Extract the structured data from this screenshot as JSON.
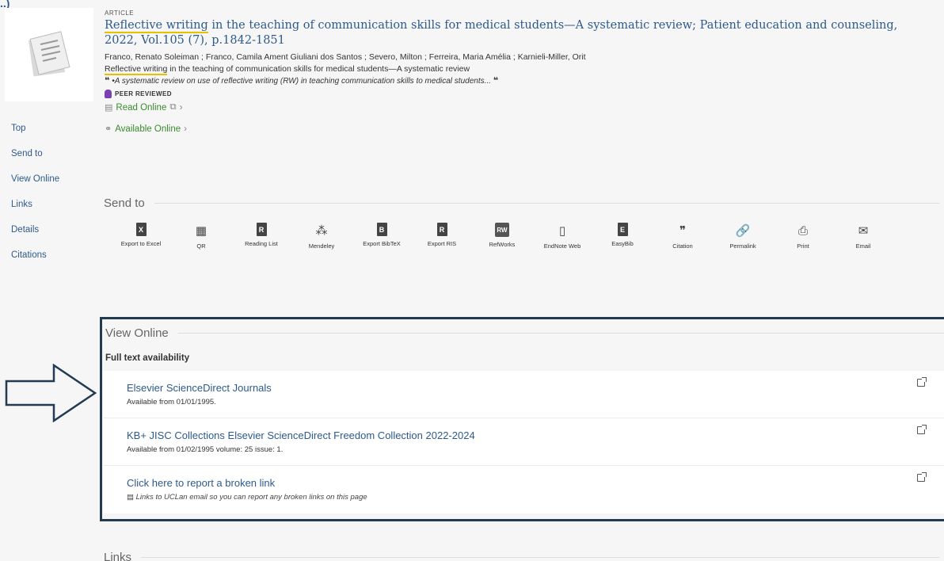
{
  "record": {
    "type": "ARTICLE",
    "title_highlight": "Reflective writing",
    "title_rest": " in the teaching of communication skills for medical students—A systematic review; Patient education and counseling,",
    "title_line2": "2022, Vol.105 (7), p.1842-1851",
    "authors": "Franco, Renato Soleiman ; Franco, Camila Ament Giuliani dos Santos ; Severo, Milton ; Ferreira, Maria Amélia ; Karnieli-Miller, Orit",
    "subtitle_highlight": "Reflective writing",
    "subtitle_rest": " in the teaching of communication skills for medical students—A systematic review",
    "snippet_open": "❝",
    "snippet": "•A systematic review on use of reflective writing (RW) in teaching communication skills to medical students...",
    "snippet_close": "❝",
    "peer_reviewed": "PEER REVIEWED",
    "read_online": "Read Online",
    "available_online": "Available Online"
  },
  "side_nav": [
    "Top",
    "Send to",
    "View Online",
    "Links",
    "Details",
    "Citations"
  ],
  "send_to": {
    "heading": "Send to",
    "tools": [
      {
        "label": "Export to Excel",
        "glyph": "X",
        "icon": "excel-icon"
      },
      {
        "label": "QR",
        "glyph": "▦",
        "icon": "qr-icon"
      },
      {
        "label": "Reading List",
        "glyph": "R",
        "icon": "reading-list-icon"
      },
      {
        "label": "Mendeley",
        "glyph": "⁂",
        "icon": "mendeley-icon"
      },
      {
        "label": "Export BibTeX",
        "glyph": "B",
        "icon": "bibtex-icon"
      },
      {
        "label": "Export RIS",
        "glyph": "R",
        "icon": "ris-icon"
      },
      {
        "label": "RefWorks",
        "glyph": "RW",
        "icon": "refworks-icon"
      },
      {
        "label": "EndNote Web",
        "glyph": "▯",
        "icon": "endnote-icon"
      },
      {
        "label": "EasyBib",
        "glyph": "E",
        "icon": "easybib-icon"
      },
      {
        "label": "Citation",
        "glyph": "❞",
        "icon": "citation-icon"
      },
      {
        "label": "Permalink",
        "glyph": "🔗",
        "icon": "permalink-icon"
      },
      {
        "label": "Print",
        "glyph": "⎙",
        "icon": "print-icon"
      },
      {
        "label": "Email",
        "glyph": "✉",
        "icon": "email-icon"
      }
    ]
  },
  "view_online": {
    "heading": "View Online",
    "subheading": "Full text availability",
    "items": [
      {
        "name": "Elsevier ScienceDirect Journals",
        "detail": "Available from 01/01/1995."
      },
      {
        "name": "KB+ JISC Collections Elsevier ScienceDirect Freedom Collection 2022-2024",
        "detail": "Available from 01/02/1995 volume: 25 issue: 1."
      },
      {
        "name": "Click here to report a broken link",
        "detail": "Links to UCLan email so you can report any broken links on this page"
      }
    ]
  },
  "links_heading": "Links",
  "colors": {
    "link": "#2d5a8c",
    "available": "#3a8a2e",
    "frame": "#223a52",
    "highlight": "#e8c000"
  }
}
